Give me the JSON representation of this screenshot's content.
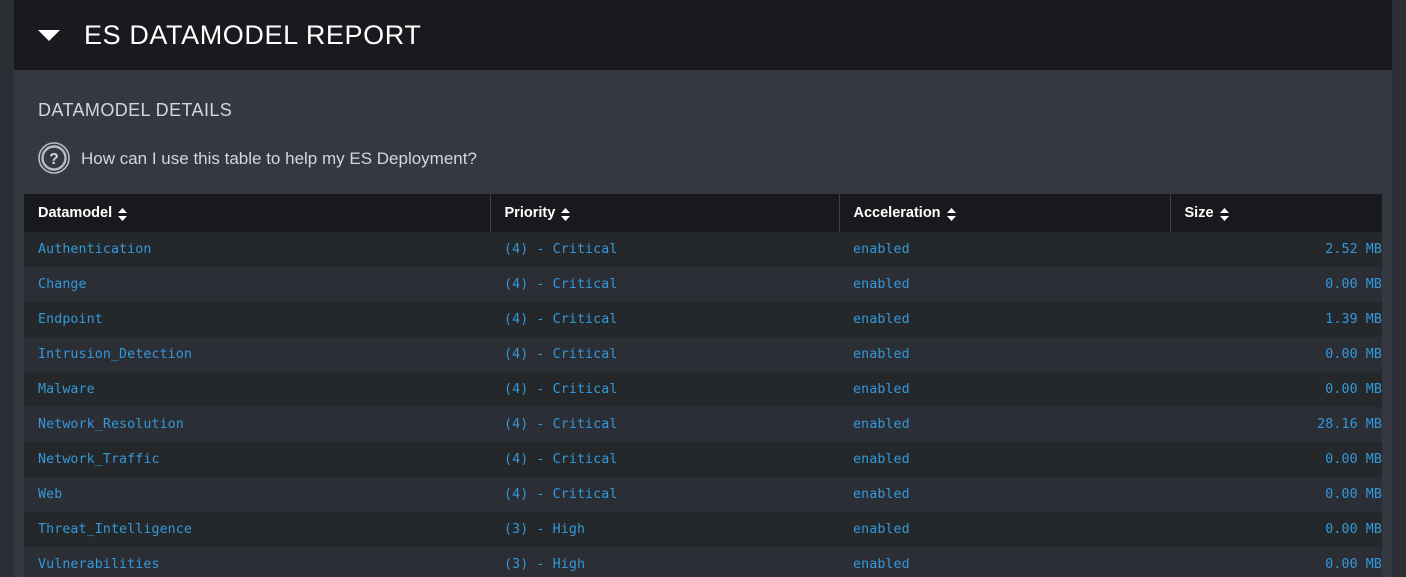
{
  "panel": {
    "title": "ES DATAMODEL REPORT",
    "caret_icon": "caret-down-icon",
    "section_title": "DATAMODEL DETAILS",
    "help": {
      "icon": "question-circle-icon",
      "text": "How can I use this table to help my ES Deployment?"
    }
  },
  "colors": {
    "page_background": "#2b2e35",
    "panel_background": "#353841",
    "panel_header_background": "#191a1e",
    "table_header_background": "#18191c",
    "row_odd": "#25282b",
    "row_even": "#2b2e35",
    "link_blue": "#3398db",
    "heading_text": "#d3d6dd",
    "title_text": "#ffffff"
  },
  "table": {
    "sort_icon": "sort-updown-icon",
    "columns": [
      {
        "label": "Datamodel",
        "sortable": true,
        "align": "left"
      },
      {
        "label": "Priority",
        "sortable": true,
        "align": "left"
      },
      {
        "label": "Acceleration",
        "sortable": true,
        "align": "left"
      },
      {
        "label": "Size",
        "sortable": true,
        "align": "right"
      }
    ],
    "rows": [
      {
        "datamodel": "Authentication",
        "priority": "(4) - Critical",
        "acceleration": "enabled",
        "size": "2.52 MB"
      },
      {
        "datamodel": "Change",
        "priority": "(4) - Critical",
        "acceleration": "enabled",
        "size": "0.00 MB"
      },
      {
        "datamodel": "Endpoint",
        "priority": "(4) - Critical",
        "acceleration": "enabled",
        "size": "1.39 MB"
      },
      {
        "datamodel": "Intrusion_Detection",
        "priority": "(4) - Critical",
        "acceleration": "enabled",
        "size": "0.00 MB"
      },
      {
        "datamodel": "Malware",
        "priority": "(4) - Critical",
        "acceleration": "enabled",
        "size": "0.00 MB"
      },
      {
        "datamodel": "Network_Resolution",
        "priority": "(4) - Critical",
        "acceleration": "enabled",
        "size": "28.16 MB"
      },
      {
        "datamodel": "Network_Traffic",
        "priority": "(4) - Critical",
        "acceleration": "enabled",
        "size": "0.00 MB"
      },
      {
        "datamodel": "Web",
        "priority": "(4) - Critical",
        "acceleration": "enabled",
        "size": "0.00 MB"
      },
      {
        "datamodel": "Threat_Intelligence",
        "priority": "(3) - High",
        "acceleration": "enabled",
        "size": "0.00 MB"
      },
      {
        "datamodel": "Vulnerabilities",
        "priority": "(3) - High",
        "acceleration": "enabled",
        "size": "0.00 MB"
      }
    ]
  }
}
